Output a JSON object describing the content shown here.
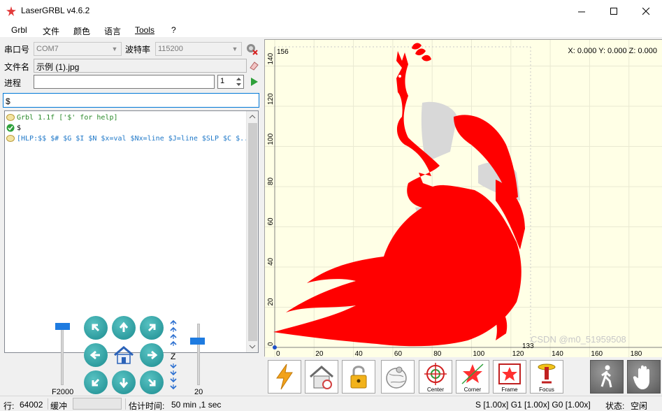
{
  "titlebar": {
    "title": "LaserGRBL v4.6.2"
  },
  "menu": [
    "Grbl",
    "文件",
    "颜色",
    "语言",
    "Tools",
    "?"
  ],
  "connection": {
    "port_label": "串口号",
    "port_value": "COM7",
    "baud_label": "波特率",
    "baud_value": "115200"
  },
  "file": {
    "label": "文件名",
    "value": "示例 (1).jpg"
  },
  "progress": {
    "label": "进程",
    "copies": "1"
  },
  "command_input": {
    "value": "$"
  },
  "console": {
    "lines": [
      {
        "text": "Grbl 1.1f ['$' for help]",
        "type": "info",
        "color": "#2a8a2a"
      },
      {
        "text": "$",
        "type": "ok",
        "color": "#000000"
      },
      {
        "text": "[HLP:$$ $# $G $I $N $x=val $Nx=line $J=line $SLP $C $...",
        "type": "info",
        "color": "#1f78c8"
      }
    ]
  },
  "jog": {
    "feed_label": "F2000",
    "step_label": "20",
    "z_label": "Z",
    "buttons": [
      "jog-up-left",
      "jog-up",
      "jog-up-right",
      "jog-left",
      "home",
      "jog-right",
      "jog-down-left",
      "jog-down",
      "jog-down-right"
    ]
  },
  "preview": {
    "coordinates": "X: 0.000 Y: 0.000 Z: 0.000",
    "top_label": "156",
    "width_label": "133",
    "x_ticks": [
      "0",
      "20",
      "40",
      "60",
      "80",
      "100",
      "120",
      "140",
      "160",
      "180"
    ],
    "y_ticks": [
      "0",
      "20",
      "40",
      "60",
      "80",
      "100",
      "120",
      "140"
    ],
    "watermark": "CSDN @m0_51959508",
    "fill_color": "#ff0000",
    "background_color": "#ffffe6"
  },
  "toolbar": [
    {
      "name": "run-button",
      "icon": "lightning-icon",
      "label": ""
    },
    {
      "name": "home-button",
      "icon": "house-icon",
      "label": ""
    },
    {
      "name": "unlock-button",
      "icon": "padlock-icon",
      "label": ""
    },
    {
      "name": "globe-button",
      "icon": "globe-pin-icon",
      "label": ""
    },
    {
      "name": "center-button",
      "icon": "crosshair-icon",
      "label": "Center"
    },
    {
      "name": "corner-button",
      "icon": "corner-star-icon",
      "label": "Corner"
    },
    {
      "name": "frame-button",
      "icon": "frame-star-icon",
      "label": "Frame"
    },
    {
      "name": "focus-button",
      "icon": "focus-icon",
      "label": "Focus"
    },
    {
      "name": "walk-button",
      "icon": "walking-person-icon",
      "label": ""
    },
    {
      "name": "stop-button",
      "icon": "hand-icon",
      "label": ""
    }
  ],
  "status": {
    "line_label": "行:",
    "line_value": "64002",
    "buffer_label": "缓冲",
    "eta_label": "估计时间:",
    "eta_value": "50 min ,1 sec",
    "overrides": "S [1.00x] G1 [1.00x] G0 [1.00x]",
    "state_label": "状态:",
    "state_value": "空闲"
  }
}
